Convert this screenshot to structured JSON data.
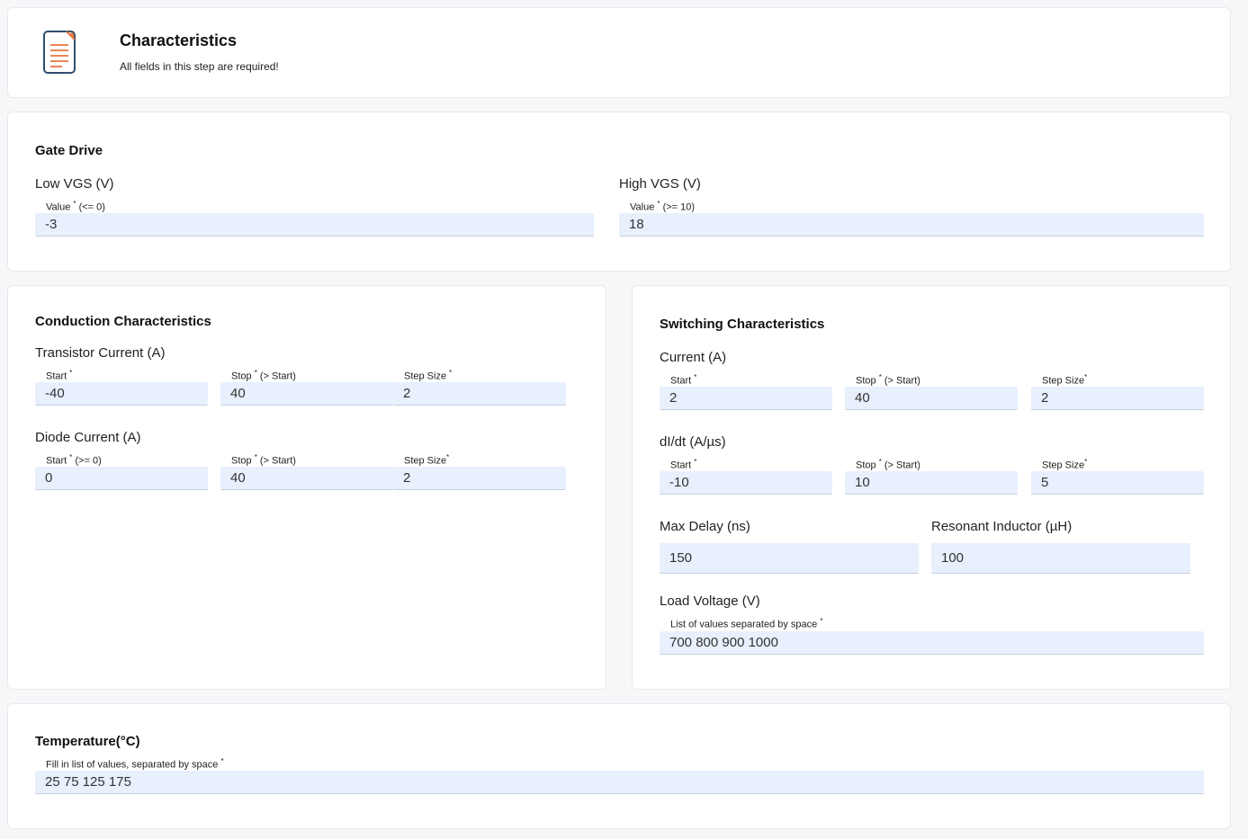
{
  "header": {
    "icon": "document-icon",
    "title": "Characteristics",
    "subtitle": "All fields in this step are required!"
  },
  "gate_drive": {
    "title": "Gate Drive",
    "low_vgs": {
      "label": "Low VGS (V)",
      "field_label": "Value",
      "hint": "(<= 0)",
      "value": "-3"
    },
    "high_vgs": {
      "label": "High VGS (V)",
      "field_label": "Value",
      "hint": "(>= 10)",
      "value": "18"
    }
  },
  "conduction": {
    "title": "Conduction Characteristics",
    "transistor": {
      "label": "Transistor Current (A)",
      "start_label": "Start",
      "start_hint": "",
      "start": "-40",
      "stop_label": "Stop",
      "stop_hint": "(> Start)",
      "stop": "40",
      "step_label": "Step Size",
      "step": "2"
    },
    "diode": {
      "label": "Diode Current (A)",
      "start_label": "Start",
      "start_hint": "(>= 0)",
      "start": "0",
      "stop_label": "Stop",
      "stop_hint": "(> Start)",
      "stop": "40",
      "step_label": "Step Size",
      "step": "2"
    }
  },
  "switching": {
    "title": "Switching Characteristics",
    "current": {
      "label": "Current (A)",
      "start_label": "Start",
      "start": "2",
      "stop_label": "Stop",
      "stop_hint": "(> Start)",
      "stop": "40",
      "step_label": "Step Size",
      "step": "2"
    },
    "didt": {
      "label": "dI/dt (A/µs)",
      "start_label": "Start",
      "start": "-10",
      "stop_label": "Stop",
      "stop_hint": "(> Start)",
      "stop": "10",
      "step_label": "Step Size",
      "step": "5"
    },
    "max_delay": {
      "label": "Max Delay (ns)",
      "value": "150"
    },
    "resonant_inductor": {
      "label": "Resonant Inductor (µH)",
      "value": "100"
    },
    "load_voltage": {
      "label": "Load Voltage (V)",
      "field_label": "List of values separated by space",
      "value": "700 800 900 1000"
    }
  },
  "temperature": {
    "title": "Temperature(°C)",
    "field_label": "Fill in list of values, separated by space",
    "value": "25 75 125 175"
  },
  "required_mark": "*",
  "colors": {
    "input_bg": "#e8f0fe",
    "card_bg": "#ffffff",
    "page_bg": "#f6f7f8",
    "icon_accent": "#e8743b",
    "icon_stroke": "#2f4f6f"
  }
}
